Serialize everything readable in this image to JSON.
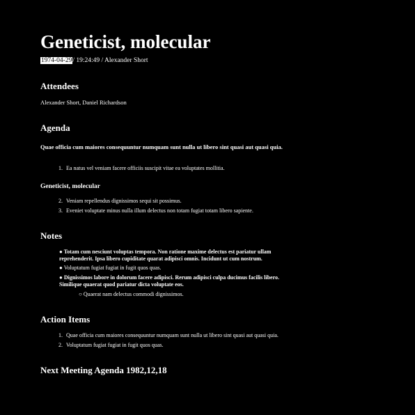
{
  "title": "Geneticist, molecular",
  "meta": {
    "date": "1974-04-29",
    "rest": "/ 19:24:49 / Alexander Short"
  },
  "attendees": {
    "heading": "Attendees",
    "names": "Alexander Short, Daniel Richardson"
  },
  "agenda": {
    "heading": "Agenda",
    "intro": "Quae officia cum maiores consequuntur numquam sunt nulla ut libero sint quasi aut quasi quia.",
    "items1": [
      {
        "num": "1.",
        "text": "Ea natus vel veniam facere officiis suscipit vitae ea voluptates mollitia."
      }
    ],
    "subheading": "Geneticist, molecular",
    "items2": [
      {
        "num": "2.",
        "text": "Veniam repellendus dignissimos sequi sit possimus."
      },
      {
        "num": "3.",
        "text": "Eveniet voluptate minus nulla illum delectus non totam fugiat totam libero sapiente."
      }
    ]
  },
  "notes": {
    "heading": "Notes",
    "bullet": "●",
    "sub_bullet": "○",
    "items": [
      {
        "text": "Totam cum nesciunt voluptas tempora. Non ratione maxime delectus est pariatur ullam reprehenderit. Ipsa libero cupiditate quarat adipisci omnis. Incidunt ut cum nostrum.",
        "bold": true
      },
      {
        "text": "Voluptatum fugiat fugiat in fugit quos quas.",
        "bold": false
      },
      {
        "text": "Dignissimos labore in dolorum facere adipisci. Rerum adipisci culpa ducimus facilis libero. Similique quaerat quod pariatur dicta voluptate eos.",
        "bold": true
      }
    ],
    "sub_item": "Quaerat nam delectus commodi dignissimos."
  },
  "action_items": {
    "heading": "Action Items",
    "items": [
      {
        "num": "1.",
        "text": "Quae officia cum maiores consequuntur numquam sunt nulla ut libero sint quasi aut quasi quia."
      },
      {
        "num": "2.",
        "text": "Voluptatum fugiat fugiat in fugit quos quas."
      }
    ]
  },
  "next_meeting": {
    "heading": "Next Meeting Agenda 1982,12,18"
  }
}
